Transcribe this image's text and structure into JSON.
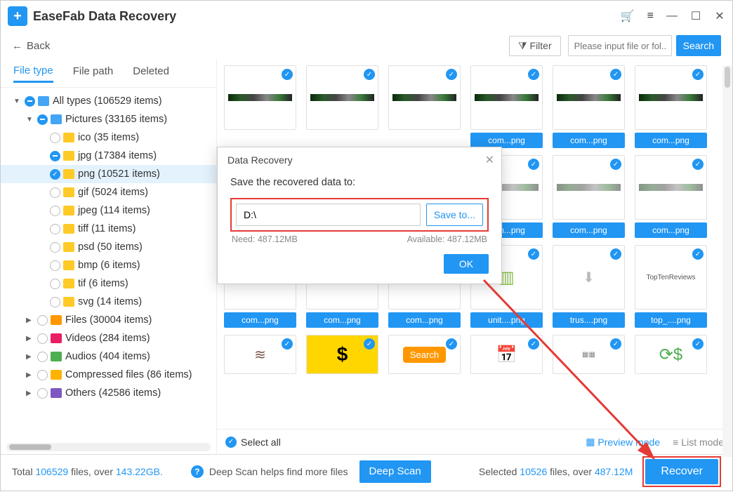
{
  "app": {
    "title": "EaseFab Data Recovery"
  },
  "toolbar": {
    "back": "Back",
    "filter": "Filter",
    "search_placeholder": "Please input file or fol...",
    "search_btn": "Search"
  },
  "tabs": {
    "file_type": "File type",
    "file_path": "File path",
    "deleted": "Deleted"
  },
  "tree": {
    "all": "All types (106529 items)",
    "pictures": "Pictures (33165 items)",
    "ico": "ico (35 items)",
    "jpg": "jpg (17384 items)",
    "png": "png (10521 items)",
    "gif": "gif (5024 items)",
    "jpeg": "jpeg (114 items)",
    "tiff": "tiff (11 items)",
    "psd": "psd (50 items)",
    "bmp": "bmp (6 items)",
    "tif": "tif (6 items)",
    "svg": "svg (14 items)",
    "files": "Files (30004 items)",
    "videos": "Videos (284 items)",
    "audios": "Audios (404 items)",
    "compressed": "Compressed files (86 items)",
    "others": "Others (42586 items)"
  },
  "thumb_labels": {
    "com_png": "com...png",
    "unit_png": "unit....png",
    "trus_png": "trus....png",
    "top_png": "top_....png"
  },
  "grid_footer": {
    "select_all": "Select all",
    "preview_mode": "Preview mode",
    "list_mode": "List mode"
  },
  "status": {
    "total_prefix": "Total ",
    "total_count": "106529",
    "total_mid": " files, over ",
    "total_size": "143.22GB.",
    "deep_hint": "Deep Scan helps find more files",
    "deep_btn": "Deep Scan",
    "sel_prefix": "Selected ",
    "sel_count": "10526",
    "sel_mid": " files, over ",
    "sel_size": "487.12M",
    "recover": "Recover"
  },
  "modal": {
    "title": "Data Recovery",
    "prompt": "Save the recovered data to:",
    "path": "D:\\",
    "save_to": "Save to...",
    "need_label": "Need: 487.12MB",
    "avail_label": "Available: 487.12MB",
    "ok": "OK"
  }
}
